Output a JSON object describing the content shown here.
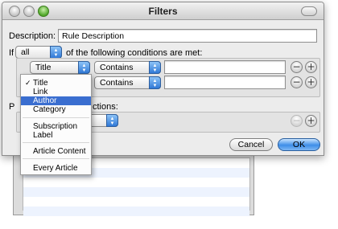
{
  "window": {
    "title": "Filters"
  },
  "description": {
    "label": "Description:",
    "value": "Rule Description"
  },
  "match": {
    "prefix": "If",
    "selected": "all",
    "suffix": "of the following conditions are met:"
  },
  "rules": [
    {
      "field": "Title",
      "operator": "Contains",
      "value": ""
    },
    {
      "field": "",
      "operator": "Contains",
      "value": ""
    }
  ],
  "actions": {
    "label_partial": "P",
    "label_tail": "ctions:"
  },
  "buttons": {
    "remove": "−",
    "add": "+",
    "cancel": "Cancel",
    "ok": "OK"
  },
  "menu": {
    "items": [
      {
        "label": "Title",
        "checked": true
      },
      {
        "label": "Link"
      },
      {
        "label": "Author",
        "selected": true
      },
      {
        "label": "Category"
      },
      {
        "label": "Subscription"
      },
      {
        "label": "Label"
      },
      {
        "label": "Article Content"
      },
      {
        "label": "Every Article"
      }
    ],
    "check_mark": "✓"
  },
  "colors": {
    "accent": "#3a6ed0",
    "default_button": "#3e8ee8"
  }
}
